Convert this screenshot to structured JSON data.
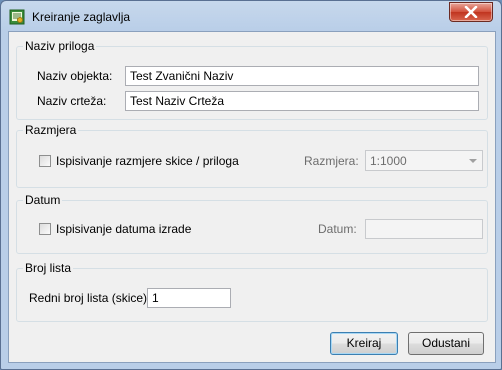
{
  "window": {
    "title": "Kreiranje zaglavlja"
  },
  "sections": {
    "naziv_priloga": {
      "legend": "Naziv priloga",
      "naziv_objekta_label": "Naziv objekta:",
      "naziv_objekta_value": "Test Zvanični Naziv",
      "naziv_crteza_label": "Naziv crteža:",
      "naziv_crteza_value": "Test Naziv Crteža"
    },
    "razmjera": {
      "legend": "Razmjera",
      "checkbox_label": "Ispisivanje razmjere skice / priloga",
      "checked": false,
      "razmjera_label": "Razmjera:",
      "razmjera_value": "1:1000"
    },
    "datum": {
      "legend": "Datum",
      "checkbox_label": "Ispisivanje datuma izrade",
      "checked": false,
      "datum_label": "Datum:",
      "datum_value": ""
    },
    "broj_lista": {
      "legend": "Broj lista",
      "redni_broj_label": "Redni broj lista (skice):",
      "redni_broj_value": "1"
    }
  },
  "buttons": {
    "kreiraj": "Kreiraj",
    "odustani": "Odustani"
  },
  "icons": {
    "app": "certificate-icon",
    "close": "close-icon"
  }
}
